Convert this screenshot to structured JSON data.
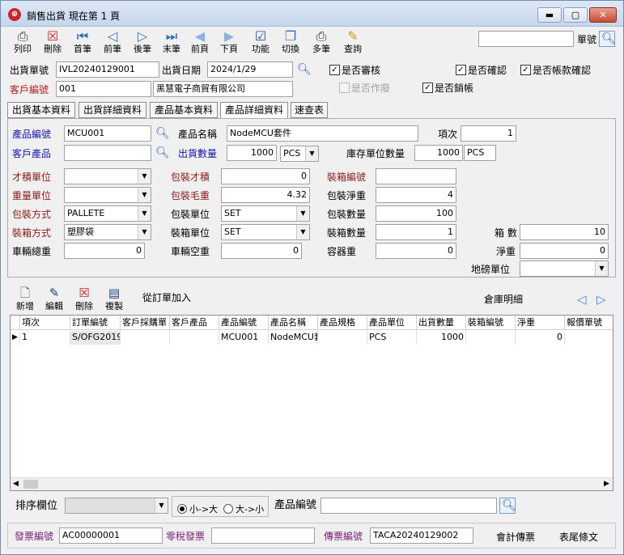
{
  "window": {
    "title": "銷售出貨  現在第 1 頁"
  },
  "toolbar": {
    "items": [
      {
        "label": "列印",
        "icon": "printer-icon"
      },
      {
        "label": "刪除",
        "icon": "delete-icon"
      },
      {
        "label": "首筆",
        "icon": "first-record-icon"
      },
      {
        "label": "前筆",
        "icon": "previous-record-icon"
      },
      {
        "label": "後筆",
        "icon": "next-record-icon"
      },
      {
        "label": "末筆",
        "icon": "last-record-icon"
      },
      {
        "label": "前頁",
        "icon": "previous-page-icon"
      },
      {
        "label": "下頁",
        "icon": "next-page-icon"
      },
      {
        "label": "功能",
        "icon": "function-icon"
      },
      {
        "label": "切換",
        "icon": "switch-icon"
      },
      {
        "label": "多筆",
        "icon": "multi-record-icon"
      },
      {
        "label": "查詢",
        "icon": "query-icon"
      }
    ],
    "doc_no_label": "單號",
    "doc_no_value": ""
  },
  "header": {
    "ship_no_label": "出貨單號",
    "ship_no_value": "IVL20240129001",
    "ship_date_label": "出貨日期",
    "ship_date_value": "2024/1/29",
    "customer_no_label": "客戶編號",
    "customer_no_value": "001",
    "customer_name_value": "黑慧電子商貿有限公司",
    "checks": [
      {
        "label": "是否審核",
        "checked": true,
        "disabled": false
      },
      {
        "label": "是否確認",
        "checked": true,
        "disabled": false
      },
      {
        "label": "是否帳款確認",
        "checked": true,
        "disabled": false
      },
      {
        "label": "是否作廢",
        "checked": false,
        "disabled": true
      },
      {
        "label": "是否銷帳",
        "checked": true,
        "disabled": false
      }
    ]
  },
  "tabs": [
    {
      "label": "出貨基本資料",
      "active": false
    },
    {
      "label": "出貨詳細資料",
      "active": false
    },
    {
      "label": "產品基本資料",
      "active": false
    },
    {
      "label": "產品詳細資料",
      "active": true
    },
    {
      "label": "速查表",
      "active": false
    }
  ],
  "detail": {
    "product_no_label": "產品編號",
    "product_no_value": "MCU001",
    "product_name_label": "產品名稱",
    "product_name_value": "NodeMCU套件",
    "item_no_label": "項次",
    "item_no_value": "1",
    "customer_product_label": "客戶產品",
    "customer_product_value": "",
    "ship_qty_label": "出貨數量",
    "ship_qty_value": "1000",
    "ship_unit_value": "PCS",
    "stock_qty_label": "庫存單位數量",
    "stock_qty_value": "1000",
    "stock_unit_value": "PCS",
    "cuft_unit_label": "才積單位",
    "cuft_unit_value": "",
    "pack_cuft_label": "包裝才積",
    "pack_cuft_value": "0",
    "box_no_label": "裝箱編號",
    "box_no_value": "",
    "weight_unit_label": "重量單位",
    "weight_unit_value": "",
    "pack_gross_label": "包裝毛重",
    "pack_gross_value": "4.32",
    "pack_net_label": "包裝淨重",
    "pack_net_value": "4",
    "pack_method_label": "包裝方式",
    "pack_method_value": "PALLETE",
    "pack_unit_label": "包裝單位",
    "pack_unit_value": "SET",
    "pack_qty_label": "包裝數量",
    "pack_qty_value": "100",
    "box_method_label": "裝箱方式",
    "box_method_value": "塑膠袋",
    "box_unit_label": "裝箱單位",
    "box_unit_value": "SET",
    "box_qty_label": "裝箱數量",
    "box_qty_value": "1",
    "box_count_label": "箱 數",
    "box_count_value": "10",
    "vehicle_total_label": "車輛總重",
    "vehicle_total_value": "0",
    "vehicle_empty_label": "車輛空重",
    "vehicle_empty_value": "0",
    "container_weight_label": "容器重",
    "container_weight_value": "0",
    "net_weight_label": "淨重",
    "net_weight_value": "0",
    "scale_unit_label": "地磅單位",
    "scale_unit_value": ""
  },
  "subtoolbar": {
    "items": [
      {
        "label": "新增",
        "icon": "new-document-icon"
      },
      {
        "label": "編輯",
        "icon": "edit-icon"
      },
      {
        "label": "刪除",
        "icon": "delete-icon"
      },
      {
        "label": "複製",
        "icon": "copy-icon"
      }
    ],
    "from_order_label": "從訂單加入",
    "warehouse_detail_label": "倉庫明細"
  },
  "grid": {
    "columns": [
      "項次",
      "訂單編號",
      "客戶採購單",
      "客戶產品",
      "產品編號",
      "產品名稱",
      "產品規格",
      "產品單位",
      "出貨數量",
      "裝箱編號",
      "淨重",
      "報價單號"
    ],
    "rows": [
      [
        "1",
        "S/OFG2019",
        "",
        "",
        "MCU001",
        "NodeMCU套",
        "",
        "PCS",
        "1000",
        "",
        "0",
        ""
      ]
    ]
  },
  "sortbar": {
    "sort_label": "排序欄位",
    "sort_value": "",
    "asc_label": "小->大",
    "desc_label": "大->小",
    "product_no_label": "產品編號",
    "product_no_value": ""
  },
  "footer": {
    "invoice_no_label": "發票編號",
    "invoice_no_value": "AC00000001",
    "zero_tax_label": "零稅發票",
    "zero_tax_value": "",
    "voucher_no_label": "傳票編號",
    "voucher_no_value": "TACA20240129002",
    "accounting_label": "會計傳票",
    "footer_terms_label": "表尾條文"
  }
}
